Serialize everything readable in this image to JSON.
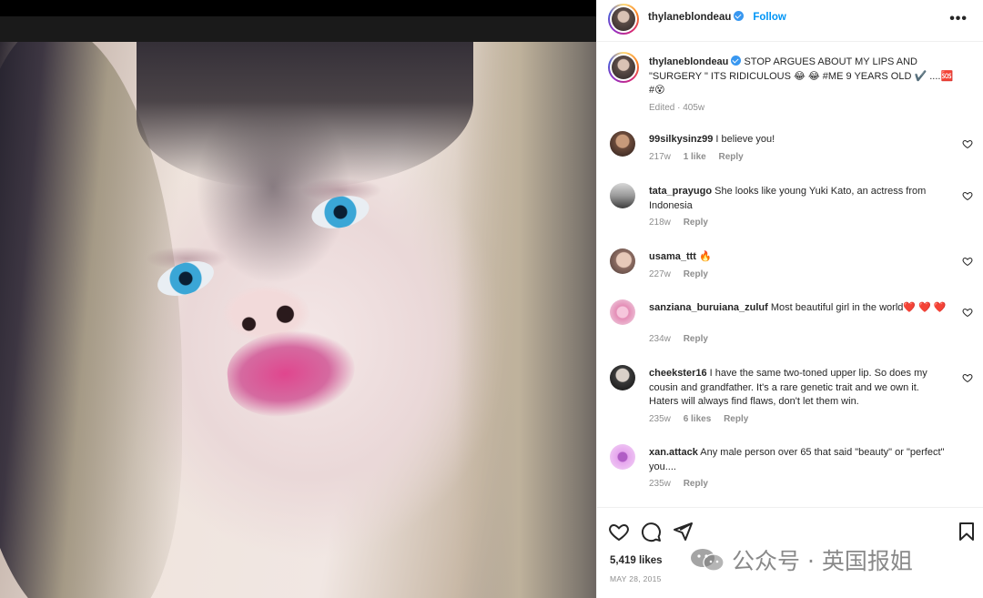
{
  "post": {
    "username": "thylaneblondeau",
    "follow_label": "Follow",
    "more_label": "•••"
  },
  "caption": {
    "username": "thylaneblondeau",
    "text": "STOP ARGUES ABOUT MY LIPS AND \"SURGERY \" ITS RIDICULOUS 😂 😂 #ME 9 YEARS OLD ✔️ ....🆘 #😵",
    "meta": "Edited · 405w"
  },
  "comments": [
    {
      "username": "99silkysinz99",
      "text": "I believe you!",
      "age": "217w",
      "likes": "1 like",
      "reply": "Reply"
    },
    {
      "username": "tata_prayugo",
      "text": "She looks like young Yuki Kato, an actress from Indonesia",
      "age": "218w",
      "likes": "",
      "reply": "Reply"
    },
    {
      "username": "usama_ttt",
      "text": "🔥",
      "age": "227w",
      "likes": "",
      "reply": "Reply"
    },
    {
      "username": "sanziana_buruiana_zuluf",
      "text": "Most beautiful girl in the world❤️ ❤️ ❤️",
      "age": "234w",
      "likes": "",
      "reply": "Reply"
    },
    {
      "username": "cheekster16",
      "text": "I have the same two-toned upper lip. So does my cousin and grandfather. It's a rare genetic trait and we own it. Haters will always find flaws, don't let them win.",
      "age": "235w",
      "likes": "6 likes",
      "reply": "Reply"
    },
    {
      "username": "xan.attack",
      "text": "Any male person over 65 that said \"beauty\" or \"perfect\" you....",
      "age": "235w",
      "likes": "",
      "reply": "Reply"
    }
  ],
  "actions": {
    "likes": "5,419 likes",
    "date": "MAY 28, 2015"
  },
  "watermark": {
    "text": "公众号 · 英国报姐"
  },
  "colors": {
    "accent": "#0095f6",
    "verified": "#3897f0",
    "muted": "#8e8e8e",
    "text": "#262626"
  },
  "icons": [
    "verified-badge-icon",
    "more-options-icon",
    "heart-icon",
    "comment-icon",
    "share-icon",
    "bookmark-icon",
    "wechat-logo-icon"
  ]
}
